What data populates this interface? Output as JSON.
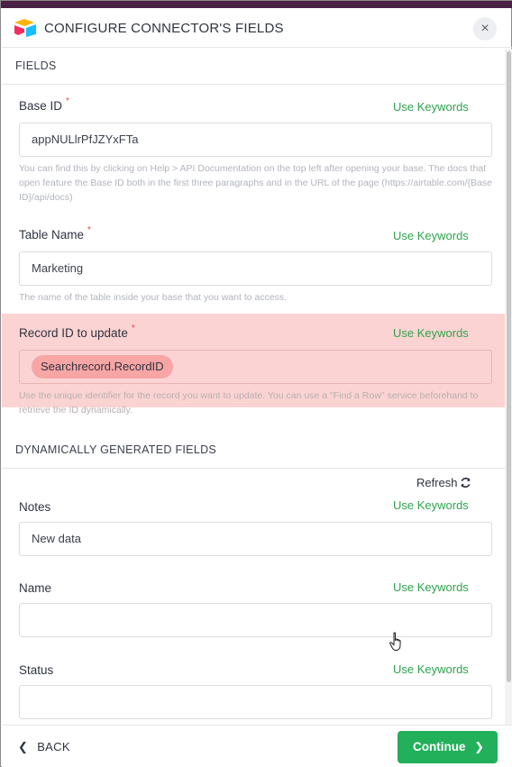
{
  "header": {
    "title": "CONFIGURE CONNECTOR'S FIELDS",
    "close_icon": "×"
  },
  "fields_section": {
    "title": "FIELDS"
  },
  "base_id": {
    "label": "Base ID",
    "required": "*",
    "keywords": "Use Keywords",
    "value": "appNULlrPfJZYxFTa",
    "help": "You can find this by clicking on Help > API Documentation on the top left after opening your base. The docs that open feature the Base ID both in the first three paragraphs and in the URL of the page (https://airtable.com/{Base ID}/api/docs)"
  },
  "table_name": {
    "label": "Table Name",
    "required": "*",
    "keywords": "Use Keywords",
    "value": "Marketing",
    "help": "The name of the table inside your base that you want to access."
  },
  "record_id": {
    "label": "Record ID to update",
    "required": "*",
    "keywords": "Use Keywords",
    "tag": "Searchrecord.RecordID",
    "help": "Use the unique identifier for the record you want to update. You can use a \"Find a Row\" service beforehand to retrieve the ID dynamically."
  },
  "dynamic_section": {
    "title": "DYNAMICALLY GENERATED FIELDS",
    "refresh_label": "Refresh"
  },
  "notes": {
    "label": "Notes",
    "keywords": "Use Keywords",
    "value": "New data"
  },
  "name": {
    "label": "Name",
    "keywords": "Use Keywords",
    "value": ""
  },
  "status": {
    "label": "Status",
    "keywords": "Use Keywords",
    "value": ""
  },
  "footer": {
    "back_label": "BACK",
    "continue_label": "Continue"
  },
  "colors": {
    "accent_green": "#22b05a",
    "keyword_green": "#2ea44f",
    "highlight_red": "#fbd3d3",
    "tag_red": "#f7a5a5",
    "required_red": "#e5484d"
  },
  "icons": [
    "airtable-logo-icon",
    "close-icon",
    "refresh-icon",
    "chevron-left-icon",
    "chevron-right-icon",
    "hand-cursor-icon"
  ]
}
